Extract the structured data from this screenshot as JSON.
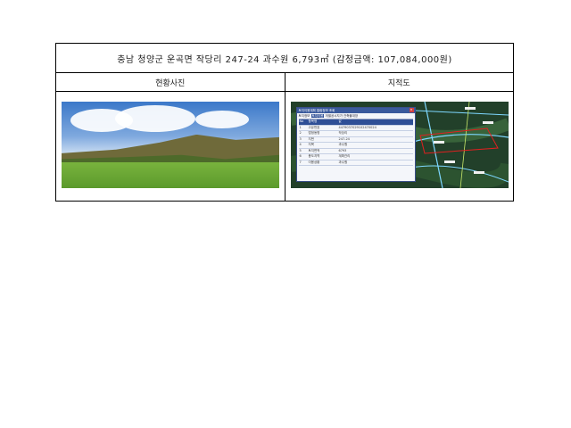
{
  "document": {
    "title": "충남 청양군 운곡면 작당리 247-24 과수원 6,793㎡ (감정금액: 107,084,000원)",
    "left_heading": "현황사진",
    "right_heading": "지적도"
  },
  "popup": {
    "title": "토지이용계획 열람정보 조회",
    "close": "×",
    "tabs": [
      "토지정보",
      "토지이용",
      "개별공시지가",
      "건축물대장"
    ],
    "active_tab": 1,
    "columns": [
      "No",
      "항목명",
      "값"
    ],
    "rows": [
      {
        "no": "1",
        "label": "고유번호",
        "value": "4479037029102470024"
      },
      {
        "no": "2",
        "label": "법정동명",
        "value": "작당리"
      },
      {
        "no": "3",
        "label": "지번",
        "value": "247-24"
      },
      {
        "no": "4",
        "label": "지목",
        "value": "과수원"
      },
      {
        "no": "5",
        "label": "토지면적",
        "value": "6793"
      },
      {
        "no": "6",
        "label": "용도지역",
        "value": "계획관리"
      },
      {
        "no": "7",
        "label": "이용상황",
        "value": "과수원"
      }
    ]
  },
  "colors": {
    "border": "#000000",
    "popup_header": "#3a5a9c",
    "parcel_outline": "#e02020",
    "map_roads": "#7ed7ff"
  }
}
